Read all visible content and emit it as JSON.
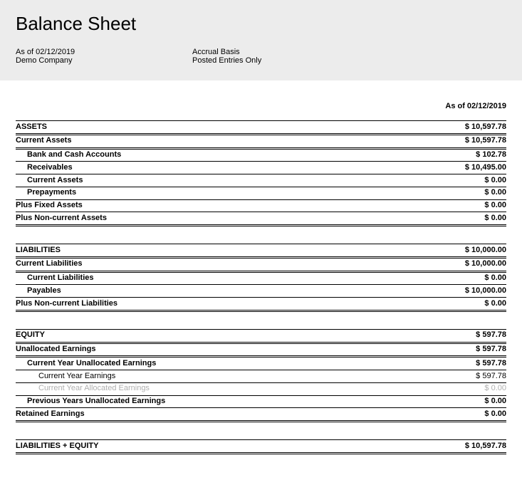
{
  "header": {
    "title": "Balance Sheet",
    "asof": "As of 02/12/2019",
    "company": "Demo Company",
    "basis": "Accrual Basis",
    "entries": "Posted Entries Only"
  },
  "date_col": "As of 02/12/2019",
  "assets": {
    "title": "ASSETS",
    "total": "$ 10,597.78",
    "current_assets_label": "Current Assets",
    "current_assets_value": "$ 10,597.78",
    "bank_label": "Bank and Cash Accounts",
    "bank_value": "$ 102.78",
    "receivables_label": "Receivables",
    "receivables_value": "$ 10,495.00",
    "current_assets2_label": "Current Assets",
    "current_assets2_value": "$ 0.00",
    "prepayments_label": "Prepayments",
    "prepayments_value": "$ 0.00",
    "fixed_label": "Plus Fixed Assets",
    "fixed_value": "$ 0.00",
    "noncurrent_label": "Plus Non-current Assets",
    "noncurrent_value": "$ 0.00"
  },
  "liabilities": {
    "title": "LIABILITIES",
    "total": "$ 10,000.00",
    "current_label": "Current Liabilities",
    "current_value": "$ 10,000.00",
    "current2_label": "Current Liabilities",
    "current2_value": "$ 0.00",
    "payables_label": "Payables",
    "payables_value": "$ 10,000.00",
    "noncurrent_label": "Plus Non-current Liabilities",
    "noncurrent_value": "$ 0.00"
  },
  "equity": {
    "title": "EQUITY",
    "total": "$ 597.78",
    "unallocated_label": "Unallocated Earnings",
    "unallocated_value": "$ 597.78",
    "cy_unallocated_label": "Current Year Unallocated Earnings",
    "cy_unallocated_value": "$ 597.78",
    "cy_earnings_label": "Current Year Earnings",
    "cy_earnings_value": "$ 597.78",
    "cy_allocated_label": "Current Year Allocated Earnings",
    "cy_allocated_value": "$ 0.00",
    "prev_label": "Previous Years Unallocated Earnings",
    "prev_value": "$ 0.00",
    "retained_label": "Retained Earnings",
    "retained_value": "$ 0.00"
  },
  "total": {
    "label": "LIABILITIES + EQUITY",
    "value": "$ 10,597.78"
  }
}
